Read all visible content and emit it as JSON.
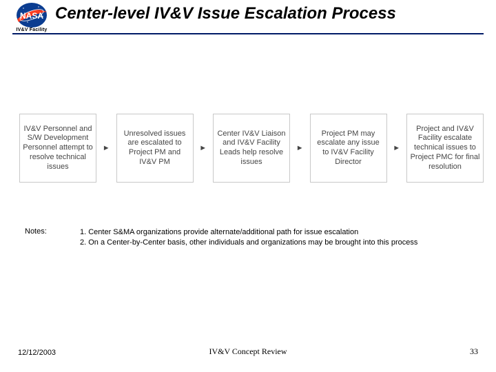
{
  "header": {
    "facility_label": "IV&V Facility",
    "title": "Center-level IV&V Issue Escalation Process"
  },
  "flow": {
    "boxes": [
      "IV&V Personnel and S/W Development Personnel attempt to resolve technical issues",
      "Unresolved issues are escalated to Project PM and IV&V PM",
      "Center IV&V Liaison and IV&V Facility Leads help resolve issues",
      "Project PM may escalate any issue to IV&V Facility Director",
      "Project and IV&V Facility escalate technical issues to Project PMC for final resolution"
    ]
  },
  "notes": {
    "label": "Notes:",
    "lines": [
      "1. Center S&MA organizations provide alternate/additional path for issue escalation",
      "2. On a Center-by-Center basis, other individuals and organizations may be brought into this process"
    ]
  },
  "footer": {
    "date": "12/12/2003",
    "center": "IV&V Concept Review",
    "page": "33"
  }
}
